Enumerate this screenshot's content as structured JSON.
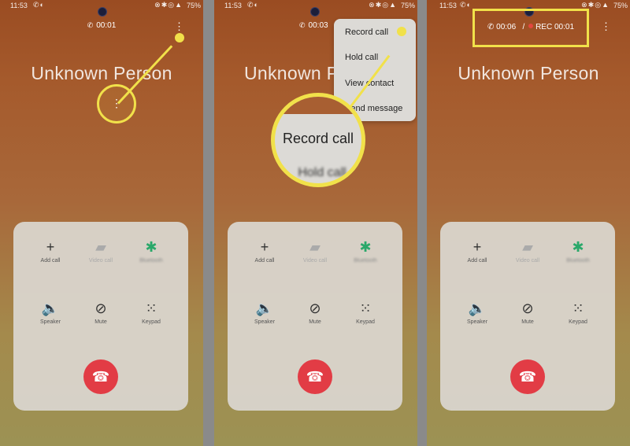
{
  "status": {
    "time": "11:53",
    "battery": "75%"
  },
  "caller_name": "Unknown Person",
  "panels": [
    {
      "call_timer": "00:01"
    },
    {
      "call_timer": "00:03"
    },
    {
      "call_timer": "00:06",
      "separator": "/",
      "rec_label": "REC",
      "rec_timer": "00:01"
    }
  ],
  "controls": {
    "add_call": "Add call",
    "video_call": "Video call",
    "bluetooth": "Bluetooth",
    "speaker": "Speaker",
    "mute": "Mute",
    "keypad": "Keypad"
  },
  "menu": {
    "record_call": "Record call",
    "hold_call": "Hold call",
    "view_contact": "View contact",
    "send_message": "Send message"
  },
  "magnifier": {
    "label": "Record call",
    "ghost": "Hold call"
  },
  "icons": [
    "phone-icon",
    "more-vert-icon",
    "plus-icon",
    "video-icon",
    "bluetooth-icon",
    "speaker-icon",
    "mute-icon",
    "keypad-icon",
    "end-call-icon",
    "rec-dot-icon"
  ],
  "colors": {
    "annotation": "#f1e14a",
    "end_call": "#e23c45",
    "bluetooth": "#2aa86a",
    "rec_dot": "#e2473f"
  }
}
